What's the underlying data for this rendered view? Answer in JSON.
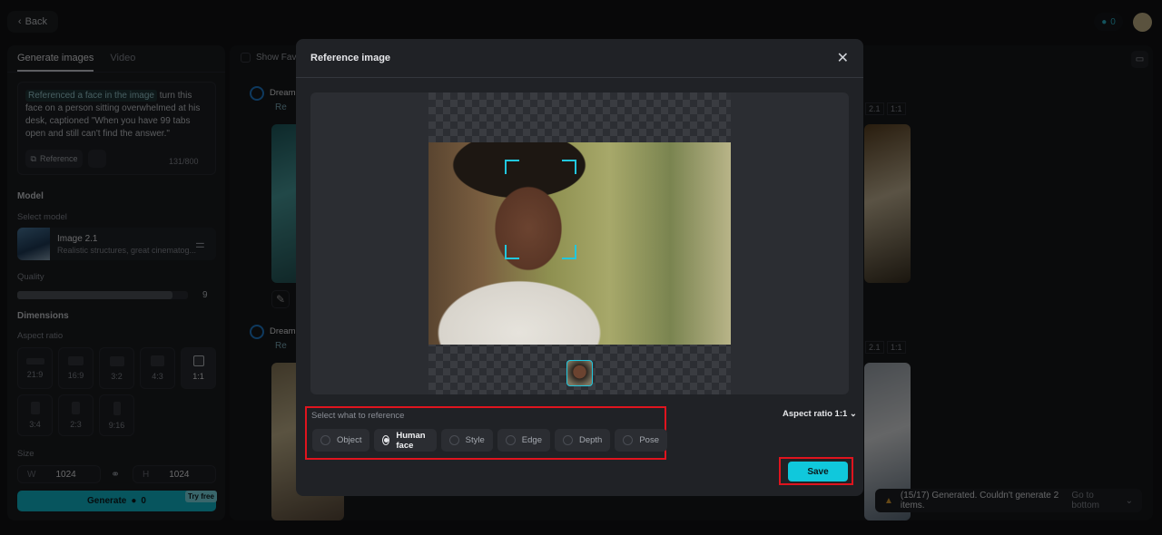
{
  "topbar": {
    "back_label": "Back",
    "credits": "0"
  },
  "sidebar": {
    "tabs": [
      "Generate images",
      "Video"
    ],
    "prompt": {
      "chip": "Referenced a face in the image",
      "text": "turn this face on a person sitting overwhelmed at his desk, captioned \"When you have 99 tabs open and still can't find the answer.\"",
      "reference_label": "Reference",
      "count": "131/800"
    },
    "model": {
      "section": "Model",
      "select_label": "Select model",
      "name": "Image 2.1",
      "desc": "Realistic structures, great cinematog..."
    },
    "quality": {
      "label": "Quality",
      "value": "9",
      "fraction": 0.91
    },
    "dimensions": {
      "section": "Dimensions",
      "aspect_label": "Aspect ratio",
      "ratios": [
        "21:9",
        "16:9",
        "3:2",
        "4:3",
        "1:1",
        "3:4",
        "2:3",
        "9:16"
      ],
      "selected": "1:1"
    },
    "size": {
      "label": "Size",
      "w_label": "W",
      "w": "1024",
      "h_label": "H",
      "h": "1024"
    },
    "generate": {
      "label": "Generate",
      "cost": "0",
      "badge": "Try free"
    }
  },
  "main": {
    "show_favorites": "Show Favorites",
    "items": [
      {
        "title": "Dream",
        "ref": "Re"
      },
      {
        "title": "Dream",
        "ref": "Re"
      }
    ],
    "tags": [
      "2.1",
      "1:1"
    ],
    "toast": {
      "text": "(15/17) Generated. Couldn't generate 2 items.",
      "action": "Go to bottom"
    }
  },
  "modal": {
    "title": "Reference image",
    "select_label": "Select what to reference",
    "options": [
      "Object",
      "Human face",
      "Style",
      "Edge",
      "Depth",
      "Pose"
    ],
    "selected": "Human face",
    "aspect_label": "Aspect ratio 1:1",
    "save_label": "Save"
  },
  "colors": {
    "accent": "#10c8dc",
    "highlight": "#e0141e"
  }
}
